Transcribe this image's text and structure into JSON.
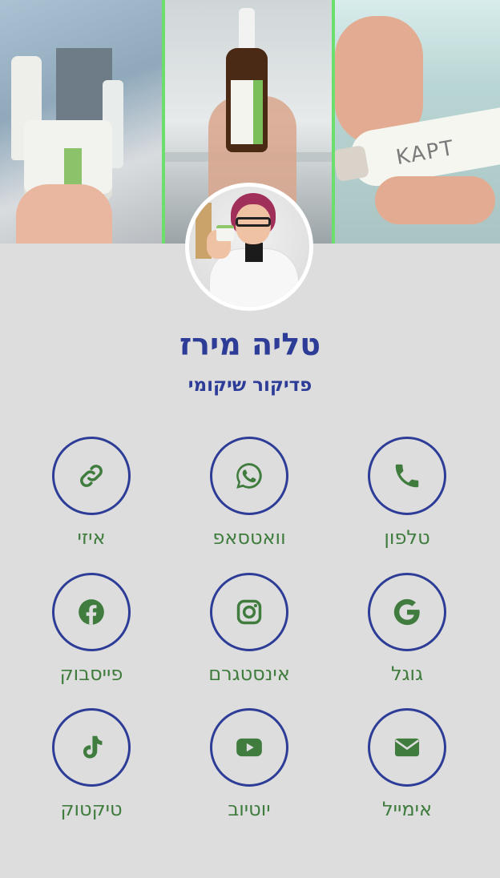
{
  "profile": {
    "name": "טליה מירז",
    "title": "פדיקור שיקומי",
    "hero_product_text": "KAPT"
  },
  "colors": {
    "background": "#dddddd",
    "primary_blue": "#2d3c97",
    "icon_green": "#3f7c3e",
    "hero_divider": "#6bde6b"
  },
  "actions": [
    {
      "label": "טלפון",
      "icon": "phone-icon"
    },
    {
      "label": "וואטסאפ",
      "icon": "whatsapp-icon"
    },
    {
      "label": "איזי",
      "icon": "link-icon"
    },
    {
      "label": "גוגל",
      "icon": "google-icon"
    },
    {
      "label": "אינסטגרם",
      "icon": "instagram-icon"
    },
    {
      "label": "פייסבוק",
      "icon": "facebook-icon"
    },
    {
      "label": "אימייל",
      "icon": "email-icon"
    },
    {
      "label": "יוטיוב",
      "icon": "youtube-icon"
    },
    {
      "label": "טיקטוק",
      "icon": "tiktok-icon"
    }
  ]
}
